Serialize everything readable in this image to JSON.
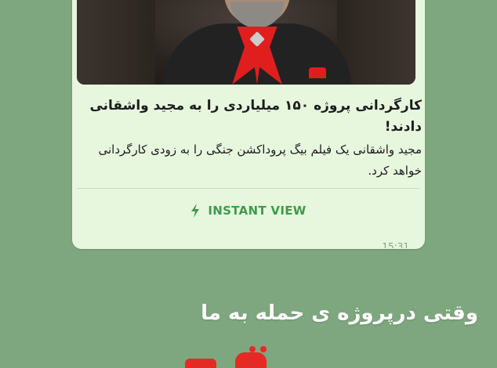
{
  "post": {
    "title": "کارگردانی پروژه ۱۵۰ میلیاردی را به مجید واشقانی دادند!",
    "description": "مجید واشقانی یک فیلم بیگ پروداکشن جنگی را به زودی کارگردانی خواهد کرد.",
    "instant_view_label": "INSTANT VIEW",
    "time": "15:31",
    "accent_color": "#3f9a4a",
    "bubble_color": "#e6f7de"
  },
  "caption": {
    "text": "وقتی درپروژه ی حمله به ما"
  },
  "background_color": "#7fa77f"
}
